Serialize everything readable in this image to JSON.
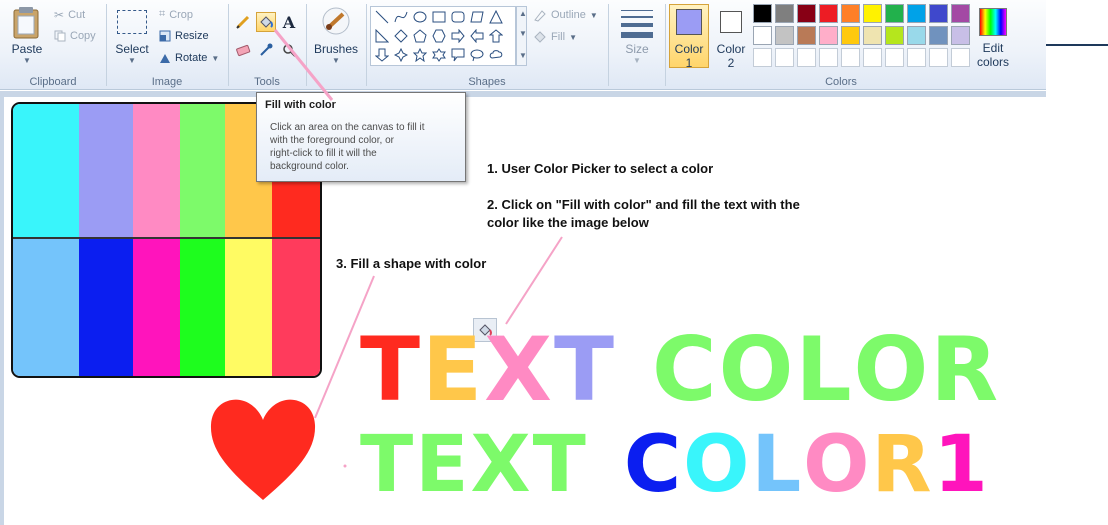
{
  "colors": {
    "accent_bg": "#ffd56b",
    "ribbon_text": "#1e395b",
    "pink_line": "#f5a3c7",
    "heart": "#ff2a1f"
  },
  "ribbon": {
    "clipboard": {
      "label": "Clipboard",
      "paste": "Paste",
      "cut": "Cut",
      "copy": "Copy"
    },
    "image": {
      "label": "Image",
      "select": "Select",
      "crop": "Crop",
      "resize": "Resize",
      "rotate": "Rotate"
    },
    "tools": {
      "label": "Tools",
      "text_tool": "A"
    },
    "brushes": {
      "label": "Brushes"
    },
    "shapes": {
      "label": "Shapes",
      "outline": "Outline",
      "fill": "Fill"
    },
    "size": {
      "label": "Size"
    },
    "colors": {
      "label": "Colors",
      "color1": "Color",
      "color1_num": "1",
      "color1_value": "#9b9cf4",
      "color2": "Color",
      "color2_num": "2",
      "color2_value": "#ffffff",
      "edit": "Edit",
      "edit2": "colors",
      "palette_row1": [
        "#000000",
        "#7f7f7f",
        "#880015",
        "#ed1c24",
        "#ff7f27",
        "#fff200",
        "#22b14c",
        "#00a2e8",
        "#3f48cc",
        "#a349a4"
      ],
      "palette_row2": [
        "#ffffff",
        "#c3c3c3",
        "#b97a57",
        "#ffaec9",
        "#ffc90e",
        "#efe4b0",
        "#b5e61d",
        "#99d9ea",
        "#7092be",
        "#c8bfe7"
      ]
    }
  },
  "tooltip": {
    "title": "Fill with color",
    "line1": "Click an area on the canvas to fill it",
    "line2": "with the foreground color, or",
    "line3": "right-click to fill it will the",
    "line4": "background color."
  },
  "instructions": {
    "step1": "1. User Color Picker to select a color",
    "step2a": "2. Click on \"Fill with color\" and fill the text with the",
    "step2b": "color like the image below",
    "step3": "3. Fill a shape with color"
  },
  "color_table": {
    "top_row": [
      "#39f5fb",
      "#9b9cf4",
      "#ff8ac3",
      "#7dfa6a",
      "#ffc74a",
      "#ff2a1f"
    ],
    "bottom_row": [
      "#74c4fb",
      "#0b1ef0",
      "#ff14bc",
      "#1efd1e",
      "#fffb63",
      "#ff3b5c"
    ]
  },
  "headline1": {
    "chars": [
      {
        "c": "T",
        "color": "#ff2a1f"
      },
      {
        "c": "E",
        "color": "#ffc74a"
      },
      {
        "c": "X",
        "color": "#ff8ac3"
      },
      {
        "c": "T",
        "color": "#9b9cf4"
      },
      {
        "c": "C",
        "color": "#7dfa6a"
      },
      {
        "c": "O",
        "color": "#7dfa6a"
      },
      {
        "c": "L",
        "color": "#7dfa6a"
      },
      {
        "c": "O",
        "color": "#7dfa6a"
      },
      {
        "c": "R",
        "color": "#7dfa6a"
      }
    ]
  },
  "headline2": {
    "chars": [
      {
        "c": "T",
        "color": "#7dfa6a"
      },
      {
        "c": "E",
        "color": "#7dfa6a"
      },
      {
        "c": "X",
        "color": "#7dfa6a"
      },
      {
        "c": "T",
        "color": "#7dfa6a"
      },
      {
        "c": "C",
        "color": "#0b1ef0"
      },
      {
        "c": "O",
        "color": "#39f5fb"
      },
      {
        "c": "L",
        "color": "#74c4fb"
      },
      {
        "c": "O",
        "color": "#ff8ac3"
      },
      {
        "c": "R",
        "color": "#ffc74a"
      },
      {
        "c": "1",
        "color": "#ff14bc"
      }
    ]
  }
}
